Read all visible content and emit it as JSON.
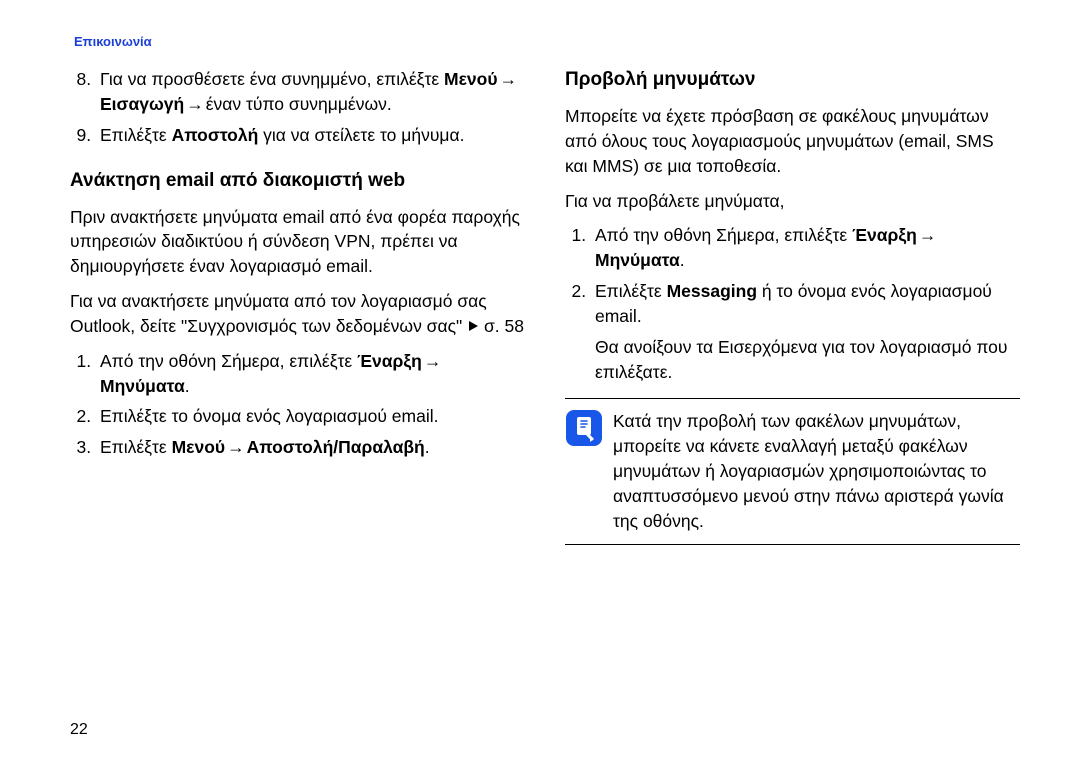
{
  "header": "Επικοινωνία",
  "page_number": "22",
  "left": {
    "cont_list_start": 8,
    "cont_items": [
      {
        "pre": "Για να προσθέσετε ένα συνημμένο, επιλέξτε ",
        "b1": "Μενού",
        "arr1": " → ",
        "b2": "Εισαγωγή",
        "arr2": " → ",
        "post": "έναν τύπο συνημμένων."
      },
      {
        "pre": "Επιλέξτε ",
        "b1": "Αποστολή",
        "post": " για να στείλετε το μήνυμα."
      }
    ],
    "h1": "Ανάκτηση email από διακομιστή web",
    "p1": "Πριν ανακτήσετε μηνύματα email από ένα φορέα παροχής υπηρεσιών διαδικτύου ή σύνδεση VPN, πρέπει να δημιουργήσετε έναν λογαριασμό email.",
    "p2_a": "Για να ανακτήσετε μηνύματα από τον λογαριασμό σας Outlook, δείτε \"Συγχρονισμός των δεδομένων σας\"",
    "p2_ref": " σ. 58",
    "steps_start": 1,
    "steps": [
      {
        "pre": "Από την οθόνη Σήμερα, επιλέξτε ",
        "b1": "Έναρξη",
        "arr1": " → ",
        "b2": "Μηνύματα",
        "post": "."
      },
      {
        "plain": "Επιλέξτε το όνομα ενός λογαριασμού email."
      },
      {
        "pre": "Επιλέξτε ",
        "b1": "Μενού",
        "arr1": " → ",
        "b2": "Αποστολή/Παραλαβή",
        "post": "."
      }
    ]
  },
  "right": {
    "h1": "Προβολή μηνυμάτων",
    "p1": "Μπορείτε να έχετε πρόσβαση σε φακέλους μηνυμάτων από όλους τους λογαριασμούς μηνυμάτων (email, SMS και MMS) σε μια τοποθεσία.",
    "p2": "Για να προβάλετε μηνύματα,",
    "steps_start": 1,
    "steps": [
      {
        "pre": "Από την οθόνη Σήμερα, επιλέξτε ",
        "b1": "Έναρξη",
        "arr1": " → ",
        "b2": "Μηνύματα",
        "post": "."
      },
      {
        "pre": "Επιλέξτε ",
        "b1": "Messaging",
        "post2a": " ή το όνομα ενός λογαριασμού email.",
        "extra": "Θα ανοίξουν τα Εισερχόμενα για τον λογαριασμό που επιλέξατε."
      }
    ],
    "note": "Κατά την προβολή των φακέλων μηνυμάτων, μπορείτε να κάνετε εναλλαγή μεταξύ φακέλων μηνυμάτων ή λογαριασμών χρησιμοποιώντας το αναπτυσσόμενο μενού στην πάνω αριστερά γωνία της οθόνης."
  }
}
